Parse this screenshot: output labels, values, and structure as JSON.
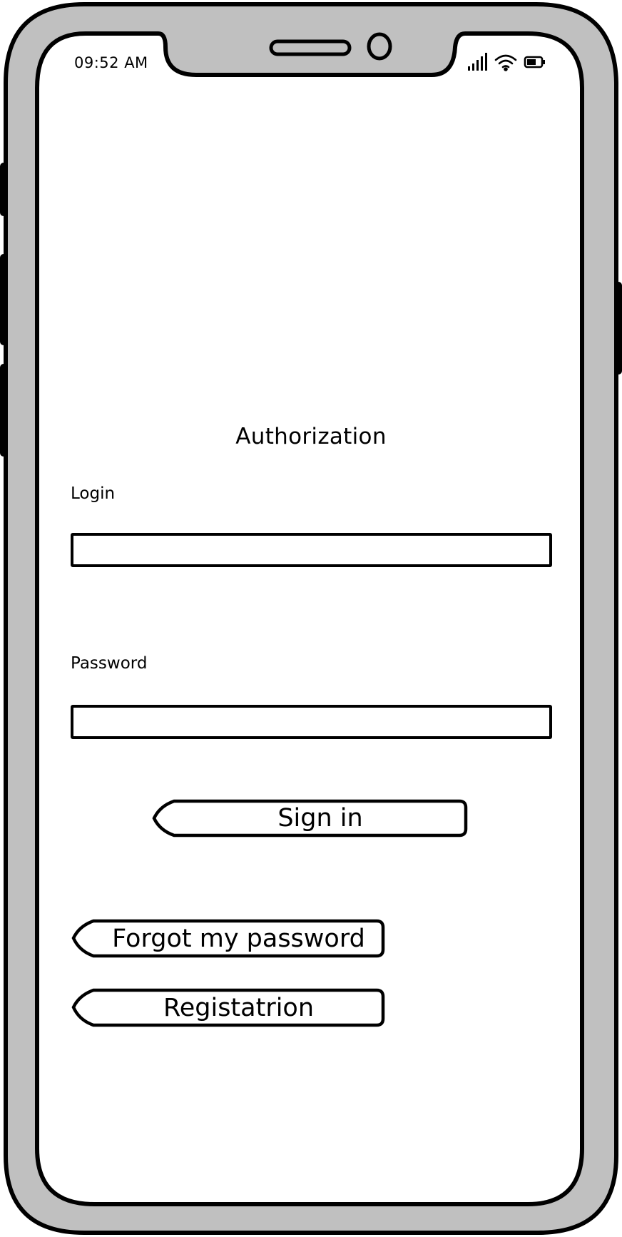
{
  "status_bar": {
    "time": "09:52 AM",
    "icons": [
      "signal-icon",
      "wifi-icon",
      "battery-icon"
    ]
  },
  "screen": {
    "title": "Authorization"
  },
  "form": {
    "login_label": "Login",
    "login_value": "",
    "password_label": "Password",
    "password_value": ""
  },
  "buttons": {
    "sign_in": "Sign in",
    "forgot_password": "Forgot my password",
    "registration": "Registatrion"
  },
  "colors": {
    "frame": "#c0c0c0",
    "outline": "#000000",
    "screen": "#ffffff"
  }
}
